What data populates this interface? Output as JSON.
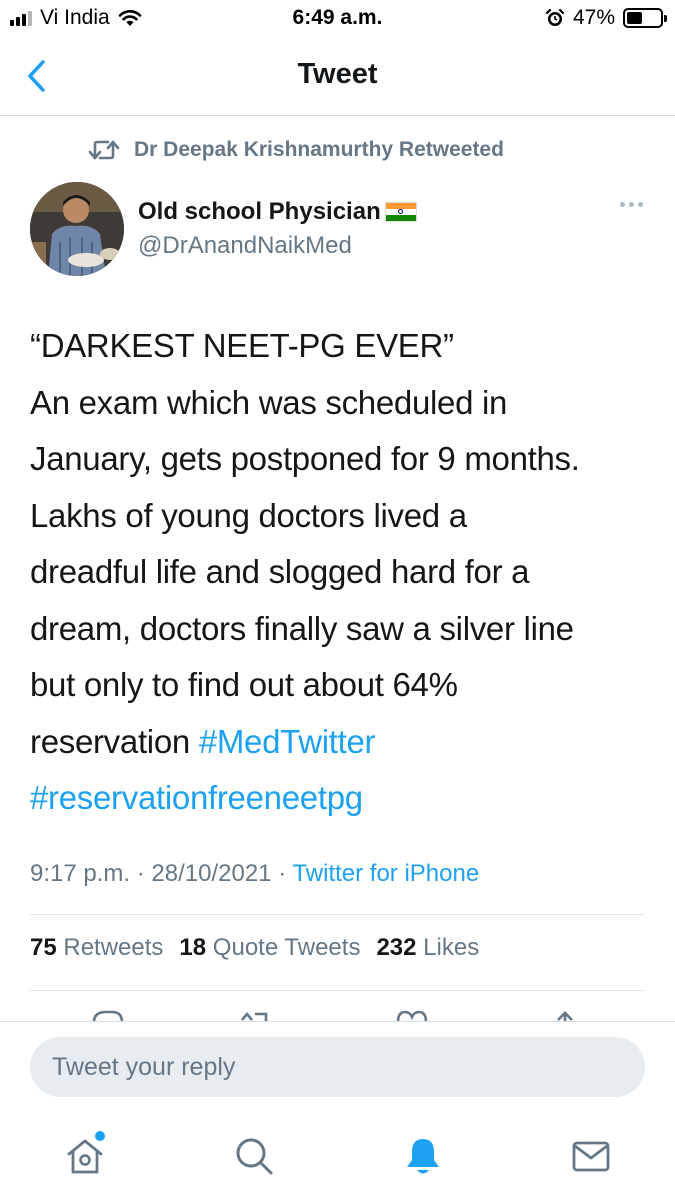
{
  "status_bar": {
    "carrier": "Vi India",
    "time": "6:49 a.m.",
    "battery_percent": "47%",
    "battery_level": 0.47,
    "signal_bars": 3
  },
  "nav": {
    "title": "Tweet",
    "back_icon": "chevron-left-icon"
  },
  "tweet": {
    "retweeted_by": "Dr Deepak Krishnamurthy Retweeted",
    "author_name": "Old school Physician",
    "author_flag": "🇮🇳",
    "author_handle": "@DrAnandNaikMed",
    "text_lines": [
      "“DARKEST NEET-PG EVER”",
      "An exam which was scheduled in",
      "January, gets postponed for 9 months.",
      "Lakhs of young doctors lived a",
      "dreadful life and slogged hard for a",
      "dream, doctors finally saw a silver line",
      "but only to find out about 64%"
    ],
    "last_line_text": "reservation ",
    "hashtags": [
      "#MedTwitter",
      "#reservationfreeneetpg"
    ],
    "time": "9:17 p.m.",
    "date": "28/10/2021",
    "separator": "·",
    "source": "Twitter for iPhone",
    "stats": {
      "retweets_count": "75",
      "retweets_label": "Retweets",
      "quote_count": "18",
      "quote_label": "Quote Tweets",
      "likes_count": "232",
      "likes_label": "Likes"
    }
  },
  "reply": {
    "placeholder": "Tweet your reply",
    "value": ""
  },
  "tab_bar": {
    "items": [
      {
        "icon": "home-icon",
        "has_dot": true,
        "active": false
      },
      {
        "icon": "search-icon",
        "has_dot": false,
        "active": false
      },
      {
        "icon": "bell-icon",
        "has_dot": false,
        "active": true
      },
      {
        "icon": "mail-icon",
        "has_dot": false,
        "active": false
      }
    ]
  },
  "colors": {
    "accent": "#1da1f2",
    "secondary_text": "#657786",
    "primary_text": "#14171a"
  }
}
